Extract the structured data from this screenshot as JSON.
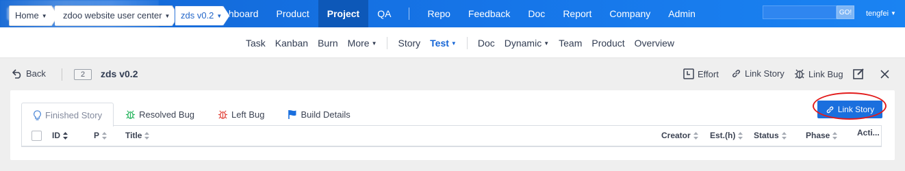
{
  "topnav": {
    "items": [
      {
        "label": "Dashboard"
      },
      {
        "label": "Product"
      },
      {
        "label": "Project",
        "active": true
      },
      {
        "label": "QA"
      },
      {
        "label": "Repo"
      },
      {
        "label": "Feedback"
      },
      {
        "label": "Doc"
      },
      {
        "label": "Report"
      },
      {
        "label": "Company"
      },
      {
        "label": "Admin"
      }
    ],
    "search_button": "GO!",
    "user": "tengfei"
  },
  "breadcrumb": {
    "home": "Home",
    "product": "zdoo website user center",
    "build": "zds v0.2"
  },
  "subnav": {
    "items": [
      "Task",
      "Kanban",
      "Burn",
      "More",
      "Story",
      "Test",
      "Doc",
      "Dynamic",
      "Team",
      "Product",
      "Overview"
    ]
  },
  "toolbar": {
    "back": "Back",
    "build_id": "2",
    "build_name": "zds v0.2",
    "effort": "Effort",
    "link_story": "Link Story",
    "link_bug": "Link Bug"
  },
  "tabs": [
    {
      "label": "Finished Story",
      "icon": "lightbulb-icon"
    },
    {
      "label": "Resolved Bug",
      "icon": "bug-icon"
    },
    {
      "label": "Left Bug",
      "icon": "bug-icon"
    },
    {
      "label": "Build Details",
      "icon": "flag-icon"
    }
  ],
  "panel": {
    "link_story_button": "Link Story"
  },
  "table": {
    "columns": [
      "ID",
      "P",
      "Title",
      "Creator",
      "Est.(h)",
      "Status",
      "Phase",
      "Acti..."
    ]
  },
  "colors": {
    "topbar": "#1675e8",
    "accent": "#1a6fde",
    "highlight": "#e21b1b"
  }
}
